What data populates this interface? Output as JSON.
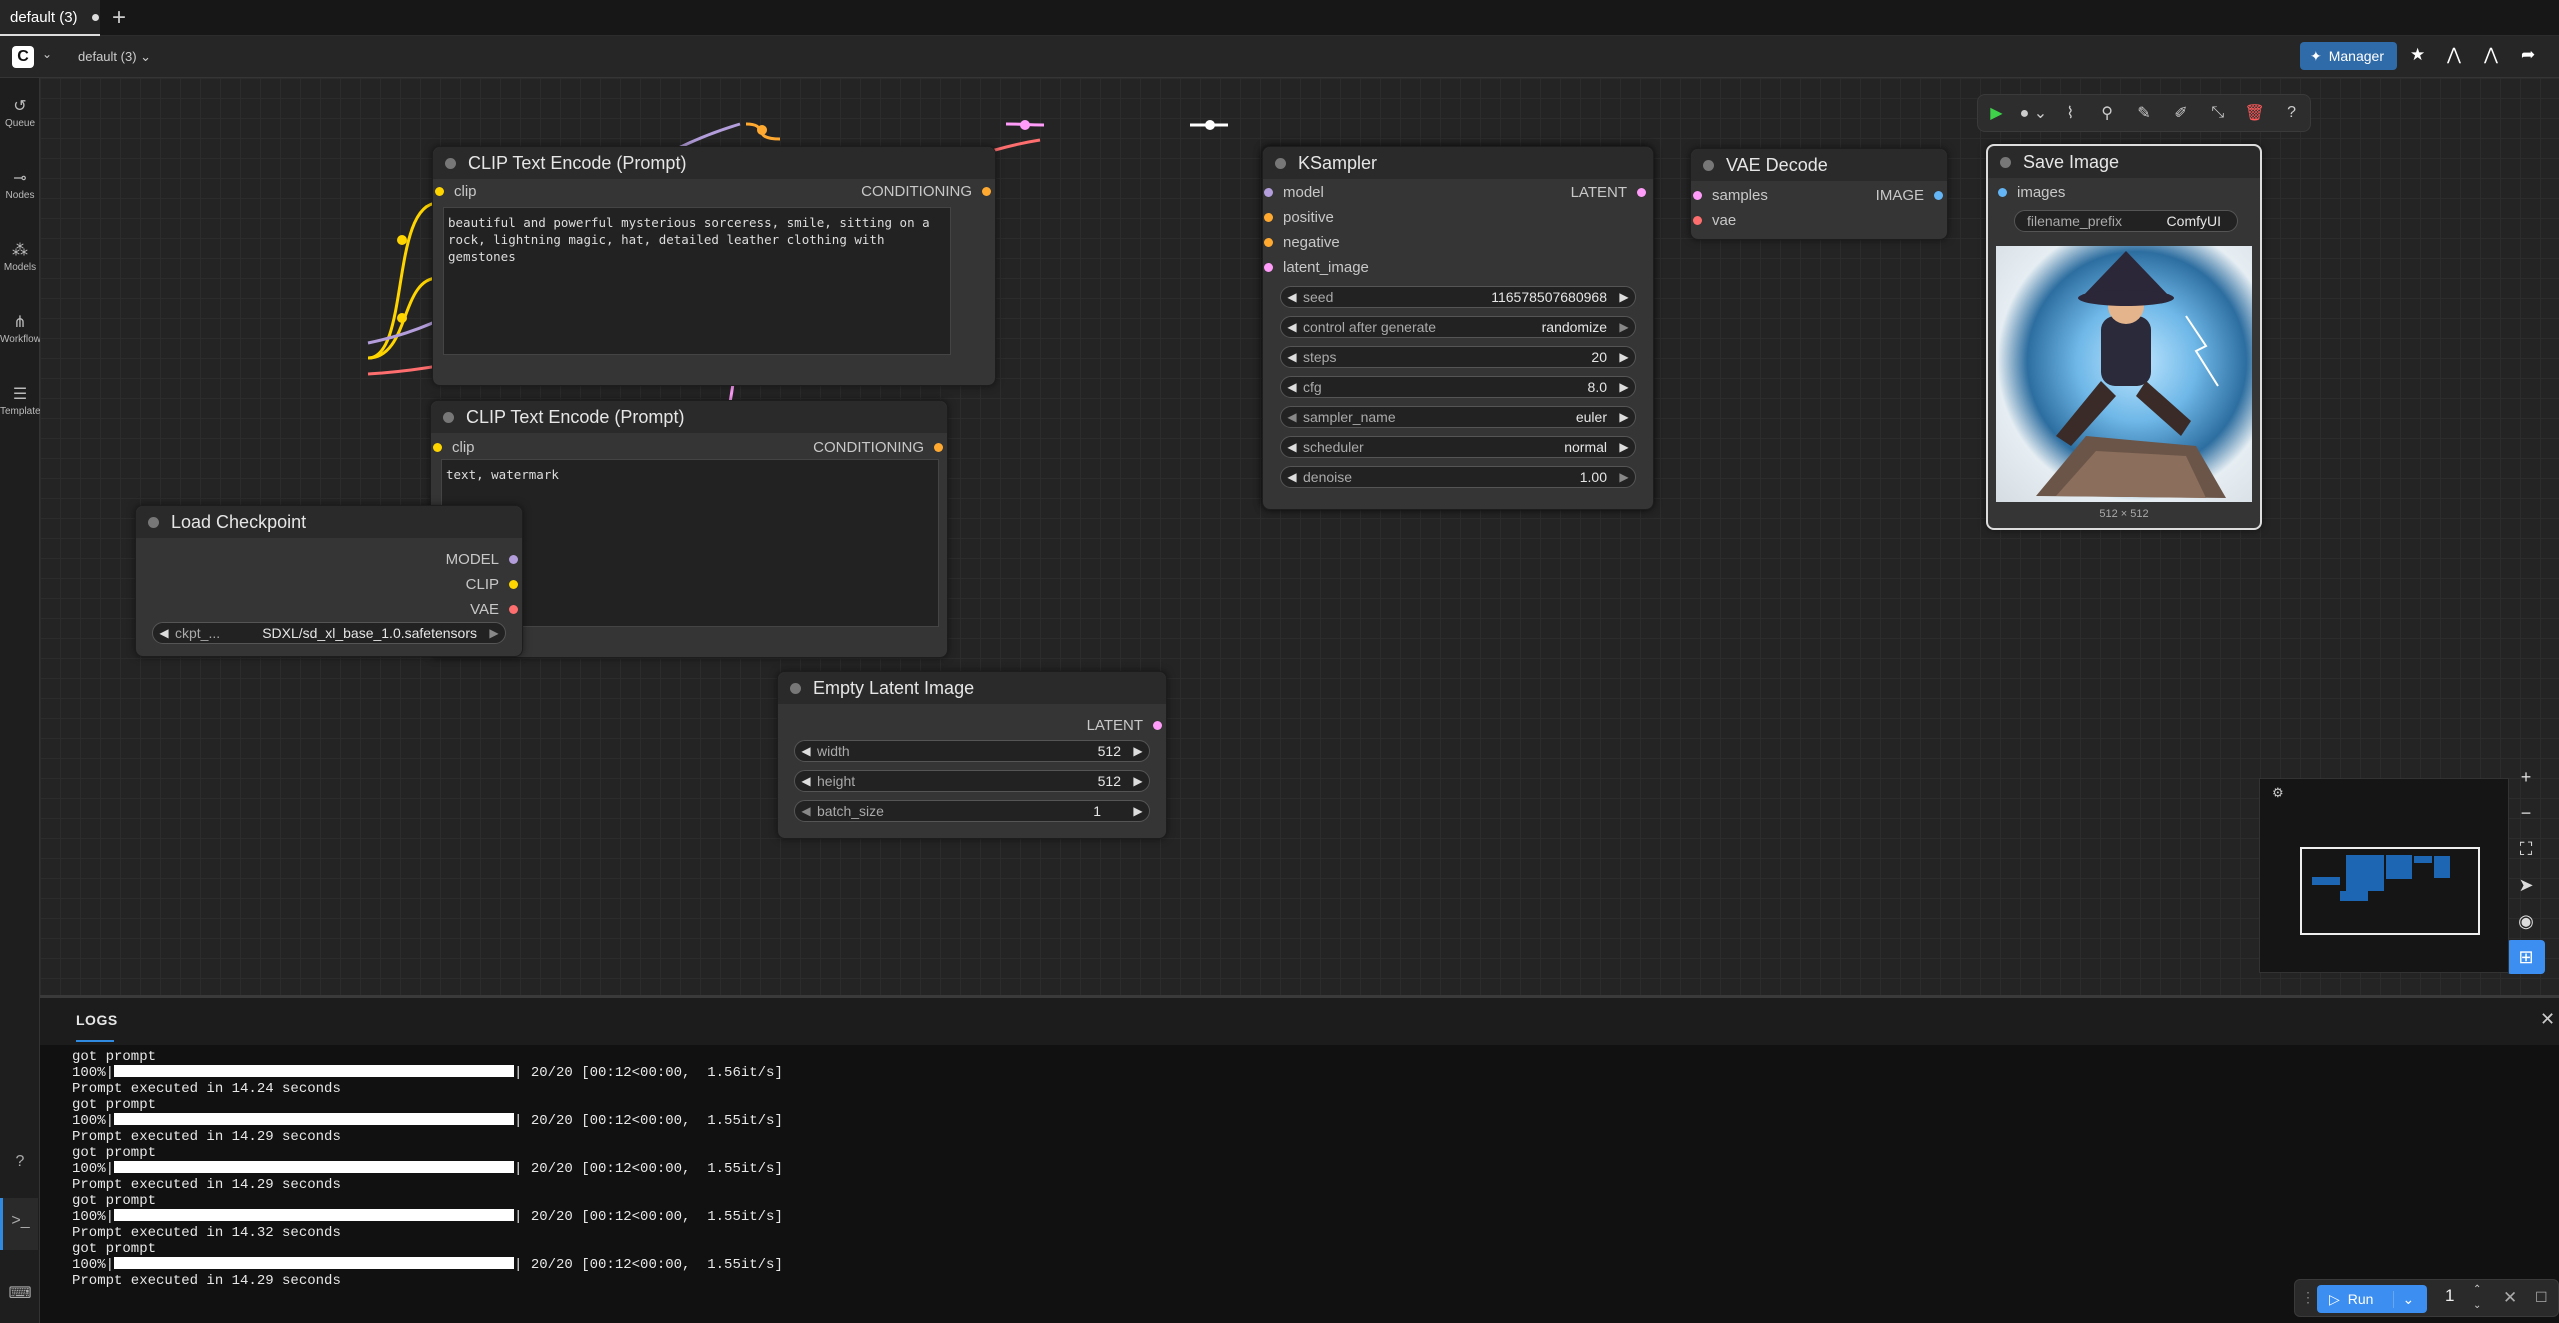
{
  "tabs": [
    {
      "label": "default (3)",
      "modified": true
    }
  ],
  "menubar": {
    "workflow_name": "default (3)",
    "manager_label": "Manager"
  },
  "sidebar": {
    "items": [
      {
        "label": "Queue",
        "icon": "history-icon"
      },
      {
        "label": "Nodes",
        "icon": "nodes-icon"
      },
      {
        "label": "Models",
        "icon": "models-icon"
      },
      {
        "label": "Workflows",
        "icon": "workflows-icon"
      },
      {
        "label": "Templates",
        "icon": "templates-icon"
      }
    ]
  },
  "nodes": {
    "clip_pos": {
      "title": "CLIP Text Encode (Prompt)",
      "input": "clip",
      "output": "CONDITIONING",
      "text": "beautiful and powerful mysterious sorceress, smile, sitting on a\nrock, lightning magic, hat, detailed leather clothing with\ngemstones"
    },
    "clip_neg": {
      "title": "CLIP Text Encode (Prompt)",
      "input": "clip",
      "output": "CONDITIONING",
      "text": "text, watermark"
    },
    "ksampler": {
      "title": "KSampler",
      "inputs": [
        "model",
        "positive",
        "negative",
        "latent_image"
      ],
      "output": "LATENT",
      "widgets": [
        {
          "label": "seed",
          "value": "116578507680968"
        },
        {
          "label": "control after generate",
          "value": "randomize"
        },
        {
          "label": "steps",
          "value": "20"
        },
        {
          "label": "cfg",
          "value": "8.0"
        },
        {
          "label": "sampler_name",
          "value": "euler"
        },
        {
          "label": "scheduler",
          "value": "normal"
        },
        {
          "label": "denoise",
          "value": "1.00"
        }
      ]
    },
    "vae_decode": {
      "title": "VAE Decode",
      "inputs": [
        "samples",
        "vae"
      ],
      "output": "IMAGE"
    },
    "save_image": {
      "title": "Save Image",
      "input": "images",
      "widget_label": "filename_prefix",
      "widget_value": "ComfyUI",
      "image_size": "512 × 512"
    },
    "load_checkpoint": {
      "title": "Load Checkpoint",
      "outputs": [
        "MODEL",
        "CLIP",
        "VAE"
      ],
      "widget_label": "ckpt_...",
      "widget_value": "SDXL/sd_xl_base_1.0.safetensors"
    },
    "empty_latent": {
      "title": "Empty Latent Image",
      "output": "LATENT",
      "widgets": [
        {
          "label": "width",
          "value": "512"
        },
        {
          "label": "height",
          "value": "512"
        },
        {
          "label": "batch_size",
          "value": "1"
        }
      ]
    }
  },
  "logs": {
    "tab_label": "LOGS",
    "runs": [
      {
        "got": "got prompt",
        "pct": "100%|",
        "progress": "| 20/20 [00:12<00:00,  1.56it/s]",
        "done": "Prompt executed in 14.24 seconds"
      },
      {
        "got": "got prompt",
        "pct": "100%|",
        "progress": "| 20/20 [00:12<00:00,  1.55it/s]",
        "done": "Prompt executed in 14.29 seconds"
      },
      {
        "got": "got prompt",
        "pct": "100%|",
        "progress": "| 20/20 [00:12<00:00,  1.55it/s]",
        "done": "Prompt executed in 14.29 seconds"
      },
      {
        "got": "got prompt",
        "pct": "100%|",
        "progress": "| 20/20 [00:12<00:00,  1.55it/s]",
        "done": "Prompt executed in 14.32 seconds"
      },
      {
        "got": "got prompt",
        "pct": "100%|",
        "progress": "| 20/20 [00:12<00:00,  1.55it/s]",
        "done": "Prompt executed in 14.29 seconds"
      }
    ]
  },
  "run": {
    "label": "Run",
    "count": "1"
  },
  "colors": {
    "clip": "#ffd500",
    "model": "#b39ddb",
    "vae": "#ff6e6e",
    "latent": "#ff9cf9",
    "conditioning": "#ffa931",
    "image": "#64b5f6",
    "accent": "#3c8ff0"
  }
}
